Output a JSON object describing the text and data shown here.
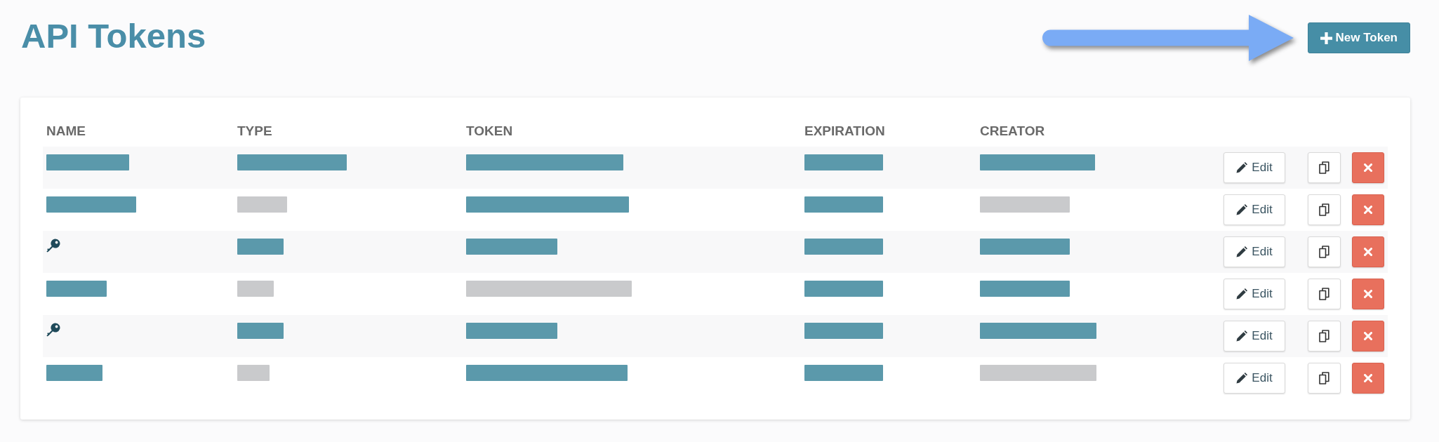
{
  "page": {
    "title": "API Tokens"
  },
  "annotation": {
    "kind": "arrow"
  },
  "new_token_button": {
    "label": "New Token"
  },
  "table": {
    "columns": [
      "NAME",
      "TYPE",
      "TOKEN",
      "EXPIRATION",
      "CREATOR"
    ],
    "rows": [
      {
        "cells": [
          {
            "kind": "redacted",
            "color": "#5b99ab"
          },
          {
            "kind": "redacted",
            "color": "#5b99ab"
          },
          {
            "kind": "redacted",
            "color": "#5b99ab"
          },
          {
            "kind": "redacted",
            "color": "#5b99ab"
          },
          {
            "kind": "redacted",
            "color": "#5b99ab"
          }
        ],
        "actions": [
          {
            "kind": "edit",
            "label": "Edit"
          },
          {
            "kind": "copy"
          },
          {
            "kind": "delete"
          }
        ]
      },
      {
        "cells": [
          {
            "kind": "redacted",
            "color": "#5b99ab"
          },
          {
            "kind": "redacted",
            "color": "#c9cacc"
          },
          {
            "kind": "redacted",
            "color": "#5b99ab"
          },
          {
            "kind": "redacted",
            "color": "#5b99ab"
          },
          {
            "kind": "redacted",
            "color": "#c9cacc"
          }
        ],
        "actions": [
          {
            "kind": "edit",
            "label": "Edit"
          },
          {
            "kind": "copy"
          },
          {
            "kind": "delete"
          }
        ]
      },
      {
        "cells": [
          {
            "kind": "key"
          },
          {
            "kind": "redacted",
            "color": "#5b99ab"
          },
          {
            "kind": "redacted",
            "color": "#5b99ab"
          },
          {
            "kind": "redacted",
            "color": "#5b99ab"
          },
          {
            "kind": "redacted",
            "color": "#5b99ab"
          }
        ],
        "actions": [
          {
            "kind": "edit",
            "label": "Edit"
          },
          {
            "kind": "copy"
          },
          {
            "kind": "delete"
          }
        ]
      },
      {
        "cells": [
          {
            "kind": "redacted",
            "color": "#5b99ab"
          },
          {
            "kind": "redacted",
            "color": "#c9cacc"
          },
          {
            "kind": "redacted",
            "color": "#c9cacc"
          },
          {
            "kind": "redacted",
            "color": "#5b99ab"
          },
          {
            "kind": "redacted",
            "color": "#5b99ab"
          }
        ],
        "actions": [
          {
            "kind": "edit",
            "label": "Edit"
          },
          {
            "kind": "copy"
          },
          {
            "kind": "delete"
          }
        ]
      },
      {
        "cells": [
          {
            "kind": "key"
          },
          {
            "kind": "redacted",
            "color": "#5b99ab"
          },
          {
            "kind": "redacted",
            "color": "#5b99ab"
          },
          {
            "kind": "redacted",
            "color": "#5b99ab"
          },
          {
            "kind": "redacted",
            "color": "#5b99ab"
          }
        ],
        "actions": [
          {
            "kind": "edit",
            "label": "Edit"
          },
          {
            "kind": "copy"
          },
          {
            "kind": "delete"
          }
        ]
      },
      {
        "cells": [
          {
            "kind": "redacted",
            "color": "#5b99ab"
          },
          {
            "kind": "redacted",
            "color": "#c9cacc"
          },
          {
            "kind": "redacted",
            "color": "#5b99ab"
          },
          {
            "kind": "redacted",
            "color": "#5b99ab"
          },
          {
            "kind": "redacted",
            "color": "#c9cacc"
          }
        ],
        "actions": [
          {
            "kind": "edit",
            "label": "Edit"
          },
          {
            "kind": "copy"
          },
          {
            "kind": "delete"
          }
        ]
      }
    ]
  }
}
